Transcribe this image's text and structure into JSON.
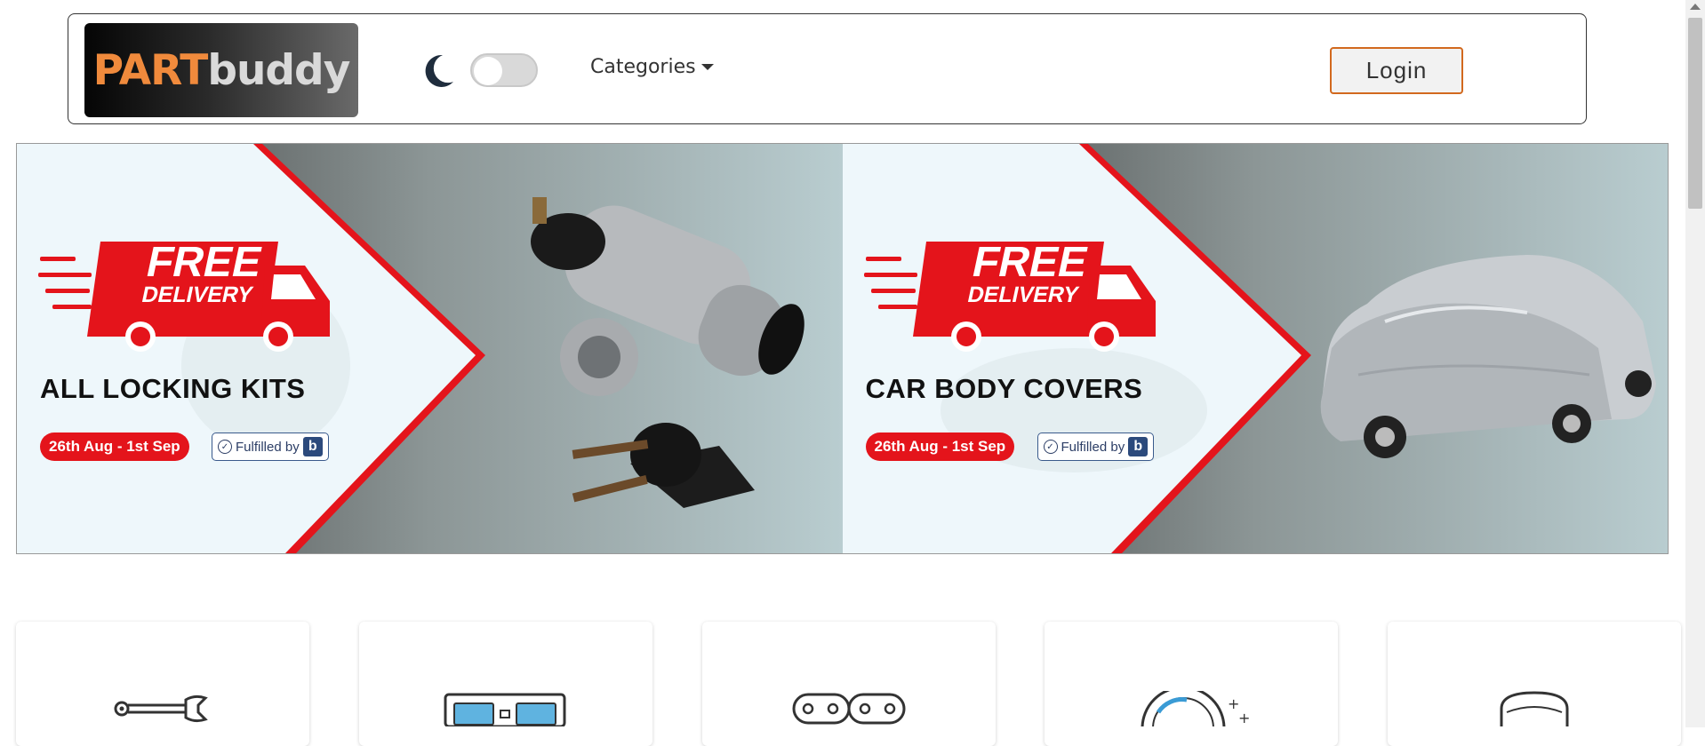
{
  "navbar": {
    "logo": {
      "part": "PART",
      "buddy": "buddy"
    },
    "dark_mode": {
      "icon": "moon-icon",
      "enabled": false
    },
    "categories_label": "Categories",
    "login_label": "Login"
  },
  "banners": [
    {
      "badge_line1": "FREE",
      "badge_line2": "DELIVERY",
      "headline": "ALL LOCKING KITS",
      "dates": "26th Aug - 1st Sep",
      "fulfilled_label": "Fulfilled by",
      "fulfilled_brand": "b",
      "product_icon": "ignition-lock-icon"
    },
    {
      "badge_line1": "FREE",
      "badge_line2": "DELIVERY",
      "headline": "CAR BODY COVERS",
      "dates": "26th Aug - 1st Sep",
      "fulfilled_label": "Fulfilled by",
      "fulfilled_brand": "b",
      "product_icon": "car-cover-icon"
    }
  ],
  "category_cards": [
    {
      "icon": "wrench-icon"
    },
    {
      "icon": "control-panel-icon"
    },
    {
      "icon": "chain-icon"
    },
    {
      "icon": "brake-disc-icon"
    },
    {
      "icon": "seat-icon"
    }
  ],
  "colors": {
    "accent_orange": "#f08a3c",
    "login_border": "#d2691e",
    "promo_red": "#e4141b"
  }
}
